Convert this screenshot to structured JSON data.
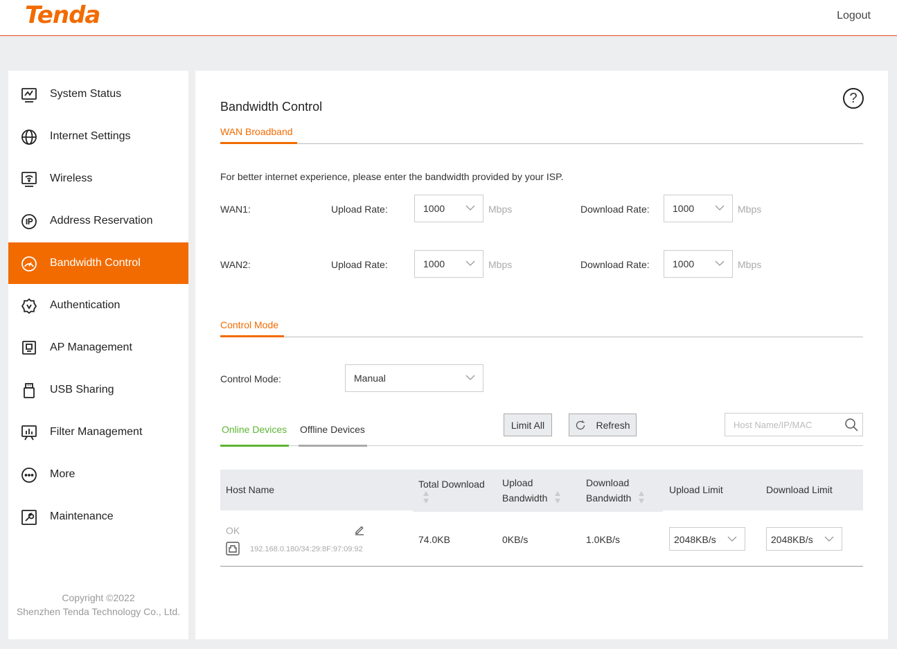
{
  "header": {
    "logo": "Tenda",
    "logout": "Logout"
  },
  "sidebar": {
    "items": [
      {
        "label": "System Status",
        "icon": "monitor-chart-icon"
      },
      {
        "label": "Internet Settings",
        "icon": "globe-icon"
      },
      {
        "label": "Wireless",
        "icon": "wifi-icon"
      },
      {
        "label": "Address Reservation",
        "icon": "ip-icon"
      },
      {
        "label": "Bandwidth Control",
        "icon": "gauge-icon",
        "active": true
      },
      {
        "label": "Authentication",
        "icon": "badge-check-icon"
      },
      {
        "label": "AP Management",
        "icon": "access-point-icon"
      },
      {
        "label": "USB Sharing",
        "icon": "usb-icon"
      },
      {
        "label": "Filter Management",
        "icon": "filter-screen-icon"
      },
      {
        "label": "More",
        "icon": "more-icon"
      },
      {
        "label": "Maintenance",
        "icon": "wrench-icon"
      }
    ],
    "copyright_line1": "Copyright ©2022",
    "copyright_line2": "Shenzhen Tenda Technology Co., Ltd."
  },
  "main": {
    "title": "Bandwidth Control",
    "wan_tab": "WAN Broadband",
    "description": "For better internet experience, please enter the bandwidth provided by your ISP.",
    "wan_rows": [
      {
        "label": "WAN1:",
        "upload_label": "Upload Rate:",
        "upload_value": "1000",
        "upload_unit": "Mbps",
        "download_label": "Download Rate:",
        "download_value": "1000",
        "download_unit": "Mbps"
      },
      {
        "label": "WAN2:",
        "upload_label": "Upload Rate:",
        "upload_value": "1000",
        "upload_unit": "Mbps",
        "download_label": "Download Rate:",
        "download_value": "1000",
        "download_unit": "Mbps"
      }
    ],
    "control_tab": "Control Mode",
    "control_mode_label": "Control Mode:",
    "control_mode_value": "Manual",
    "device_tabs": {
      "online": "Online Devices",
      "offline": "Offline Devices"
    },
    "limit_all": "Limit All",
    "refresh": "Refresh",
    "search_placeholder": "Host Name/IP/MAC",
    "table": {
      "headers": {
        "host_name": "Host Name",
        "total_download": "Total Download",
        "upload_bandwidth": [
          "Upload",
          "Bandwidth"
        ],
        "download_bandwidth": [
          "Download",
          "Bandwidth"
        ],
        "upload_limit": "Upload Limit",
        "download_limit": "Download Limit"
      },
      "rows": [
        {
          "host_name": "OK",
          "address": "192.168.0.180/34:29:8F:97:09:92",
          "total_download": "74.0KB",
          "upload_bandwidth": "0KB/s",
          "download_bandwidth": "1.0KB/s",
          "upload_limit": "2048KB/s",
          "download_limit": "2048KB/s"
        }
      ]
    }
  },
  "colors": {
    "accent": "#f26b00",
    "online_tab": "#5cb531",
    "header_line": "#e24b26"
  }
}
